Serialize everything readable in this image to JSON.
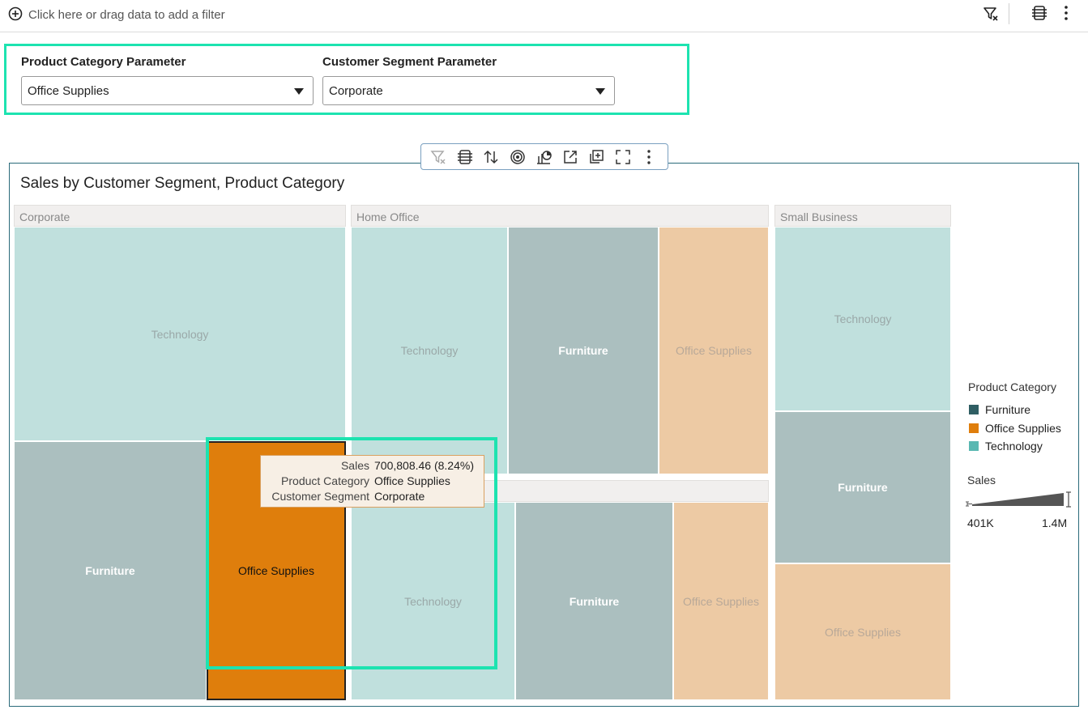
{
  "filter_bar": {
    "hint": "Click here or drag data to add a filter"
  },
  "parameters": {
    "product_category": {
      "label": "Product Category Parameter",
      "value": "Office Supplies"
    },
    "customer_segment": {
      "label": "Customer Segment Parameter",
      "value": "Corporate"
    }
  },
  "viz": {
    "title": "Sales by Customer Segment, Product Category",
    "toolbar_icons": [
      "filter-icon",
      "properties-icon",
      "sort-icon",
      "target-icon",
      "chart-type-icon",
      "export-icon",
      "add-canvas-icon",
      "fullscreen-icon",
      "more-icon"
    ]
  },
  "treemap": {
    "groups": [
      {
        "name": "Corporate",
        "tiles": [
          "Technology",
          "Furniture",
          "Office Supplies"
        ]
      },
      {
        "name": "Home Office",
        "tiles": [
          "Technology",
          "Furniture",
          "Office Supplies"
        ]
      },
      {
        "name": "Small Business",
        "tiles": [
          "Technology",
          "Furniture",
          "Office Supplies"
        ]
      },
      {
        "name": "",
        "tiles": [
          "Technology",
          "Furniture",
          "Office Supplies"
        ]
      }
    ],
    "selected": {
      "segment": "Corporate",
      "category": "Office Supplies"
    }
  },
  "tooltip": {
    "rows": [
      {
        "key": "Sales",
        "value": "700,808.46 (8.24%)"
      },
      {
        "key": "Product Category",
        "value": "Office Supplies"
      },
      {
        "key": "Customer Segment",
        "value": "Corporate"
      }
    ]
  },
  "legend": {
    "title": "Product Category",
    "items": [
      {
        "label": "Furniture",
        "color": "#2f5e63"
      },
      {
        "label": "Office Supplies",
        "color": "#df7e0c"
      },
      {
        "label": "Technology",
        "color": "#5ab8b2"
      }
    ],
    "size_title": "Sales",
    "size_min": "401K",
    "size_max": "1.4M"
  },
  "colors": {
    "accent_highlight": "#1de3b0",
    "technology": "#c0e0dd",
    "furniture": "#abbfbf",
    "office_supplies": "#edcaa4",
    "office_supplies_selected": "#df7e0c"
  }
}
